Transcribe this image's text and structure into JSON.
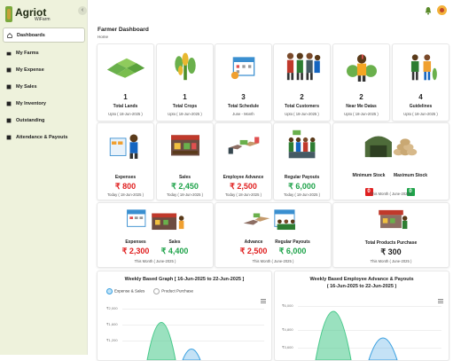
{
  "app": {
    "brand": "Agriot",
    "brand_sub": "WiFarm"
  },
  "sidebar": {
    "items": [
      {
        "label": "Dashboards",
        "active": true
      },
      {
        "label": "My Farms"
      },
      {
        "label": "My Expense"
      },
      {
        "label": "My Sales"
      },
      {
        "label": "My Inventory"
      },
      {
        "label": "Outstanding"
      },
      {
        "label": "Attendance & Payouts"
      }
    ]
  },
  "header": {
    "title": "Farmer Dashboard",
    "breadcrumb": "Home"
  },
  "row1": [
    {
      "value": "1",
      "label": "Total Lands",
      "sub": "Upto ( 18-Jun-2025 )"
    },
    {
      "value": "1",
      "label": "Total Crops",
      "sub": "Upto ( 18-Jun-2025 )"
    },
    {
      "value": "3",
      "label": "Total Schedule",
      "sub": "June - Month"
    },
    {
      "value": "2",
      "label": "Total Customers",
      "sub": "Upto ( 18-Jun-2025 )"
    },
    {
      "value": "2",
      "label": "Near Me Datas",
      "sub": "Upto ( 18-Jun-2025 )"
    },
    {
      "value": "4",
      "label": "Guidelines",
      "sub": "Upto ( 18-Jun-2025 )"
    }
  ],
  "row2": [
    {
      "label": "Expenses",
      "value": "₹ 800",
      "color": "red",
      "sub": "Today ( 18-Jun-2025 )"
    },
    {
      "label": "Sales",
      "value": "₹ 2,450",
      "color": "green",
      "sub": "Today ( 18-Jun-2025 )"
    },
    {
      "label": "Employee Advance",
      "value": "₹ 2,500",
      "color": "red",
      "sub": "Today ( 18-Jun-2025 )"
    },
    {
      "label": "Regular Payouts",
      "value": "₹ 6,000",
      "color": "green",
      "sub": "Today ( 18-Jun-2025 )"
    }
  ],
  "stock": {
    "min_label": "Minimum Stock",
    "min_value": "0",
    "max_label": "Maximum Stock",
    "max_value": "0",
    "sub": "This Month ( June-2025 )"
  },
  "row3": {
    "sales_card": {
      "expenses_label": "Expenses",
      "expenses_value": "₹ 2,300",
      "sales_label": "Sales",
      "sales_value": "₹ 4,400",
      "sub": "This Month ( June-2025 )"
    },
    "advance_card": {
      "advance_label": "Advance",
      "advance_value": "₹ 2,500",
      "payouts_label": "Regular Payouts",
      "payouts_value": "₹ 6,000",
      "sub": "This Month ( June-2025 )"
    },
    "purchase_card": {
      "label": "Total Products Purchase",
      "value": "₹ 300",
      "sub": "This Month ( June-2025 )"
    }
  },
  "graph1": {
    "title": "Weekly Based Graph [ 16-Jun-2025 to 22-Jun-2025 ]",
    "legend": [
      "Expense & Sales",
      "Product Purchase"
    ],
    "yticks": [
      "₹2,000",
      "₹1,600",
      "₹1,200"
    ]
  },
  "graph2": {
    "title": "Weekly Based Employee Advance & Payouts",
    "subtitle": "( 16-Jun-2025 to 22-Jun-2025 )",
    "yticks": [
      "₹6,000",
      "₹4,800",
      "₹3,600"
    ]
  },
  "colors": {
    "accent": "#7aa83c",
    "sidebar_bg": "#eef2dc",
    "red": "#e02020",
    "green": "#1fa34a",
    "chart_green": "#47c98a",
    "chart_blue": "#3aa0e0"
  }
}
